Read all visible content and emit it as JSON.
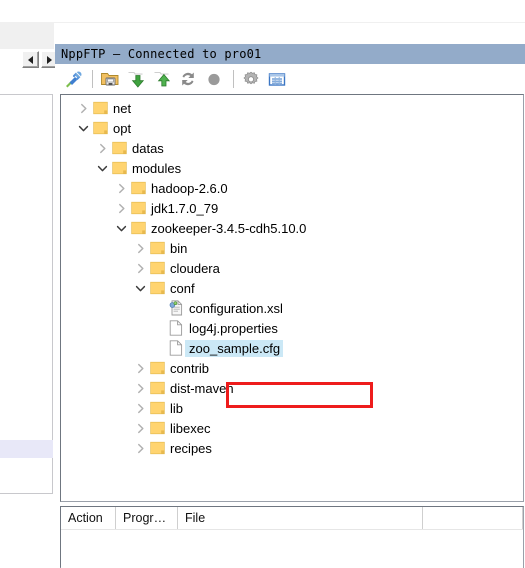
{
  "window": {
    "panel_title": "NppFTP  —  Connected to pro01"
  },
  "editor": {
    "scroll_left_label": "◀",
    "scroll_right_label": "▶"
  },
  "toolbar": {
    "buttons": [
      {
        "name": "connect-icon",
        "tooltip": "Connect"
      },
      {
        "name": "open-directory-icon",
        "tooltip": "Open Directory"
      },
      {
        "name": "download-icon",
        "tooltip": "Download"
      },
      {
        "name": "upload-icon",
        "tooltip": "Upload"
      },
      {
        "name": "refresh-icon",
        "tooltip": "Refresh"
      },
      {
        "name": "abort-icon",
        "tooltip": "Abort"
      },
      {
        "name": "settings-icon",
        "tooltip": "Settings"
      },
      {
        "name": "messages-icon",
        "tooltip": "Messages"
      }
    ]
  },
  "tree": {
    "nodes": [
      {
        "label": "net",
        "depth": 1,
        "type": "folder",
        "state": "collapsed",
        "selected": false
      },
      {
        "label": "opt",
        "depth": 1,
        "type": "folder",
        "state": "expanded",
        "selected": false
      },
      {
        "label": "datas",
        "depth": 2,
        "type": "folder",
        "state": "collapsed",
        "selected": false
      },
      {
        "label": "modules",
        "depth": 2,
        "type": "folder",
        "state": "expanded",
        "selected": false
      },
      {
        "label": "hadoop-2.6.0",
        "depth": 3,
        "type": "folder",
        "state": "collapsed",
        "selected": false
      },
      {
        "label": "jdk1.7.0_79",
        "depth": 3,
        "type": "folder",
        "state": "collapsed",
        "selected": false
      },
      {
        "label": "zookeeper-3.4.5-cdh5.10.0",
        "depth": 3,
        "type": "folder",
        "state": "expanded",
        "selected": false
      },
      {
        "label": "bin",
        "depth": 4,
        "type": "folder",
        "state": "collapsed",
        "selected": false
      },
      {
        "label": "cloudera",
        "depth": 4,
        "type": "folder",
        "state": "collapsed",
        "selected": false
      },
      {
        "label": "conf",
        "depth": 4,
        "type": "folder",
        "state": "expanded",
        "selected": false
      },
      {
        "label": "configuration.xsl",
        "depth": 5,
        "type": "xsl",
        "state": "none",
        "selected": false
      },
      {
        "label": "log4j.properties",
        "depth": 5,
        "type": "file",
        "state": "none",
        "selected": false
      },
      {
        "label": "zoo_sample.cfg",
        "depth": 5,
        "type": "file",
        "state": "none",
        "selected": true
      },
      {
        "label": "contrib",
        "depth": 4,
        "type": "folder",
        "state": "collapsed",
        "selected": false
      },
      {
        "label": "dist-maven",
        "depth": 4,
        "type": "folder",
        "state": "collapsed",
        "selected": false
      },
      {
        "label": "lib",
        "depth": 4,
        "type": "folder",
        "state": "collapsed",
        "selected": false
      },
      {
        "label": "libexec",
        "depth": 4,
        "type": "folder",
        "state": "collapsed",
        "selected": false
      },
      {
        "label": "recipes",
        "depth": 4,
        "type": "folder",
        "state": "collapsed",
        "selected": false
      }
    ]
  },
  "annotation": {
    "highlight_color": "#ee1c1c",
    "target_label": "zoo_sample.cfg"
  },
  "queue": {
    "columns": [
      "Action",
      "Progr…",
      "File"
    ],
    "rows": []
  },
  "colors": {
    "titlebar": "#93abc9",
    "selection": "#cbe8f6",
    "folder": "#ffd470",
    "annotation_red": "#ee1c1c"
  }
}
